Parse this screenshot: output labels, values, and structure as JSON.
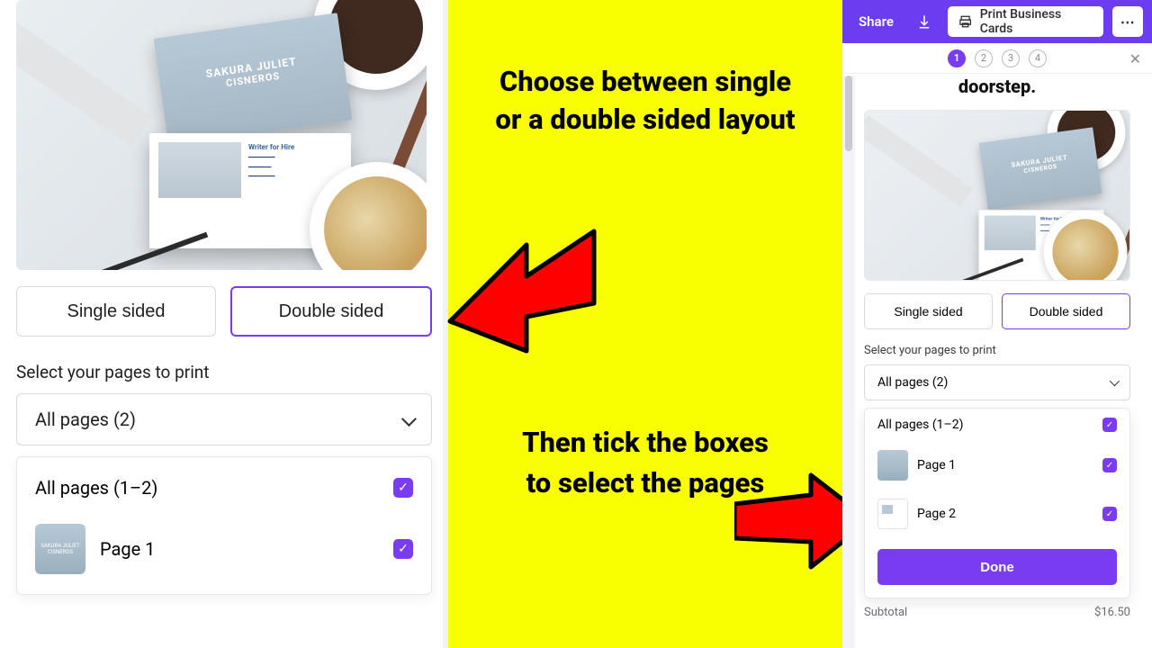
{
  "left": {
    "card_name_line1": "SAKURA JULIET",
    "card_name_line2": "CISNEROS",
    "card_role": "Writer for Hire",
    "single_label": "Single sided",
    "double_label": "Double sided",
    "section_label": "Select your pages to print",
    "dropdown_value": "All pages (2)",
    "all_pages_label": "All pages (1–2)",
    "page1_label": "Page 1"
  },
  "instructions": {
    "text1": "Choose between single or a double sided layout",
    "text2": "Then tick the boxes to select the pages"
  },
  "right": {
    "share": "Share",
    "print_button": "Print Business Cards",
    "steps": [
      "1",
      "2",
      "3",
      "4"
    ],
    "subhead": "doorstep.",
    "single_label": "Single sided",
    "double_label": "Double sided",
    "section_label": "Select your pages to print",
    "dropdown_value": "All pages (2)",
    "all_pages_label": "All pages (1–2)",
    "page1_label": "Page 1",
    "page2_label": "Page 2",
    "done": "Done",
    "subtotal_label": "Subtotal",
    "subtotal_value": "$16.50"
  },
  "colors": {
    "accent": "#7a3cf0",
    "highlight": "#faff00",
    "arrow": "#ff0000"
  }
}
